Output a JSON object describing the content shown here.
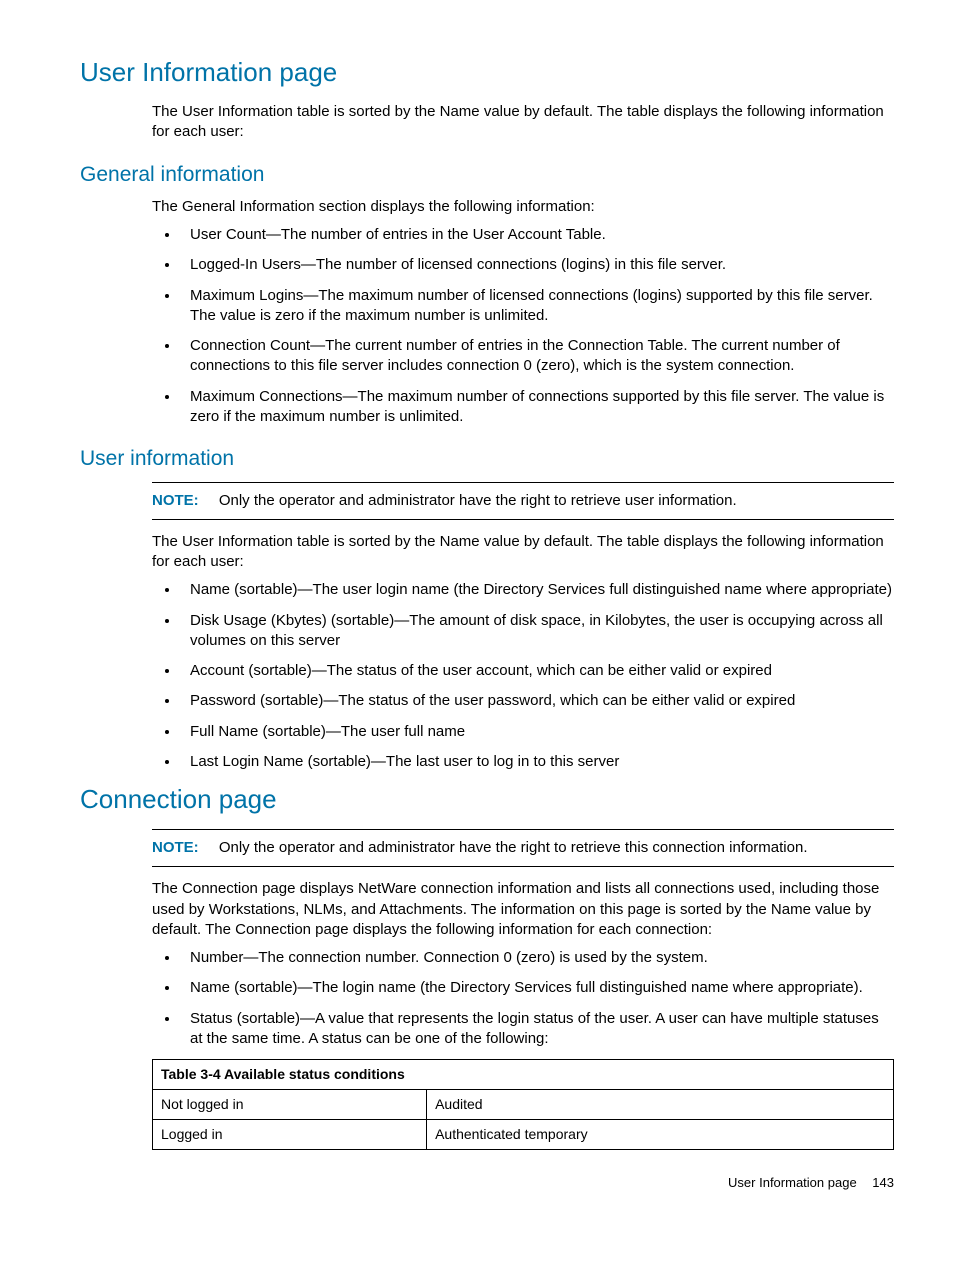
{
  "h1_user_info_page": "User Information page",
  "p_user_info_intro": "The User Information table is sorted by the Name value by default. The table displays the following information for each user:",
  "h2_general_info": "General information",
  "p_general_info_intro": "The General Information section displays the following information:",
  "general_info_items": [
    "User Count—The number of entries in the User Account Table.",
    "Logged-In Users—The number of licensed connections (logins) in this file server.",
    "Maximum Logins—The maximum number of licensed connections (logins) supported by this file server. The value is zero if the maximum number is unlimited.",
    "Connection Count—The current number of entries in the Connection Table. The current number of connections to this file server includes connection 0 (zero), which is the system connection.",
    "Maximum Connections—The maximum number of connections supported by this file server. The value is zero if the maximum number is unlimited."
  ],
  "h2_user_info": "User information",
  "note_label": "NOTE:",
  "note_user_info": "Only the operator and administrator have the right to retrieve user information.",
  "user_info_items": [
    "Name (sortable)—The user login name (the Directory Services full distinguished name where appropriate)",
    "Disk Usage (Kbytes) (sortable)—The amount of disk space, in Kilobytes, the user is occupying across all volumes on this server",
    "Account (sortable)—The status of the user account, which can be either valid or expired",
    "Password (sortable)—The status of the user password, which can be either valid or expired",
    "Full Name (sortable)—The user full name",
    "Last Login Name (sortable)—The last user to log in to this server"
  ],
  "h1_connection_page": "Connection page",
  "note_connection": "Only the operator and administrator have the right to retrieve this connection information.",
  "p_connection_intro": "The Connection page displays NetWare connection information and lists all connections used, including those used by Workstations, NLMs, and Attachments. The information on this page is sorted by the Name value by default. The Connection page displays the following information for each connection:",
  "connection_items": [
    "Number—The connection number. Connection 0 (zero) is used by the system.",
    "Name (sortable)—The login name (the Directory Services full distinguished name where appropriate).",
    "Status (sortable)—A value that represents the login status of the user. A user can have multiple statuses at the same time. A status can be one of the following:"
  ],
  "table_caption": "Table 3-4  Available status conditions",
  "table_rows": [
    [
      "Not logged in",
      "Audited"
    ],
    [
      "Logged in",
      "Authenticated temporary"
    ]
  ],
  "footer_text": "User Information page",
  "footer_page": "143"
}
